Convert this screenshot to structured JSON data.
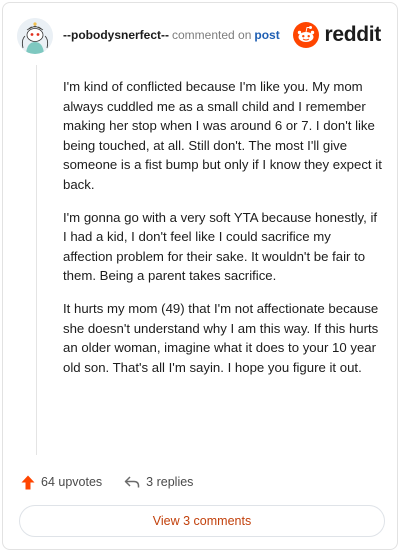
{
  "comment": {
    "author": "--pobodysnerfect--",
    "action_text": "commented on",
    "post_link": "post",
    "paragraphs": [
      "I'm kind of conflicted because I'm like you. My mom always cuddled me as a small child and I remember making her stop when I was around 6 or 7. I don't like being touched, at all. Still don't. The most I'll give someone is a fist bump but only if I know they expect it back.",
      "I'm gonna go with a very soft YTA because honestly, if I had a kid, I don't feel like I could sacrifice my affection problem for their sake. It wouldn't be fair to them. Being a parent takes sacrifice.",
      "It hurts my mom (49) that I'm not affectionate because she doesn't understand why I am this way. If this hurts an older woman, imagine what it does to your 10 year old son. That's all I'm sayin. I hope you figure it out."
    ],
    "upvotes_label": "64 upvotes",
    "replies_label": "3 replies",
    "view_comments_label": "View 3 comments"
  },
  "brand": {
    "name": "reddit",
    "color": "#ff4500"
  },
  "icons": {
    "upvote": "upvote-arrow-icon",
    "reply": "reply-arrow-icon",
    "avatar": "snoo-avatar-icon",
    "logo": "reddit-logo-icon"
  },
  "colors": {
    "accent": "#ff4500",
    "link": "#1f5fb3",
    "view_button_text": "#c2410c"
  }
}
